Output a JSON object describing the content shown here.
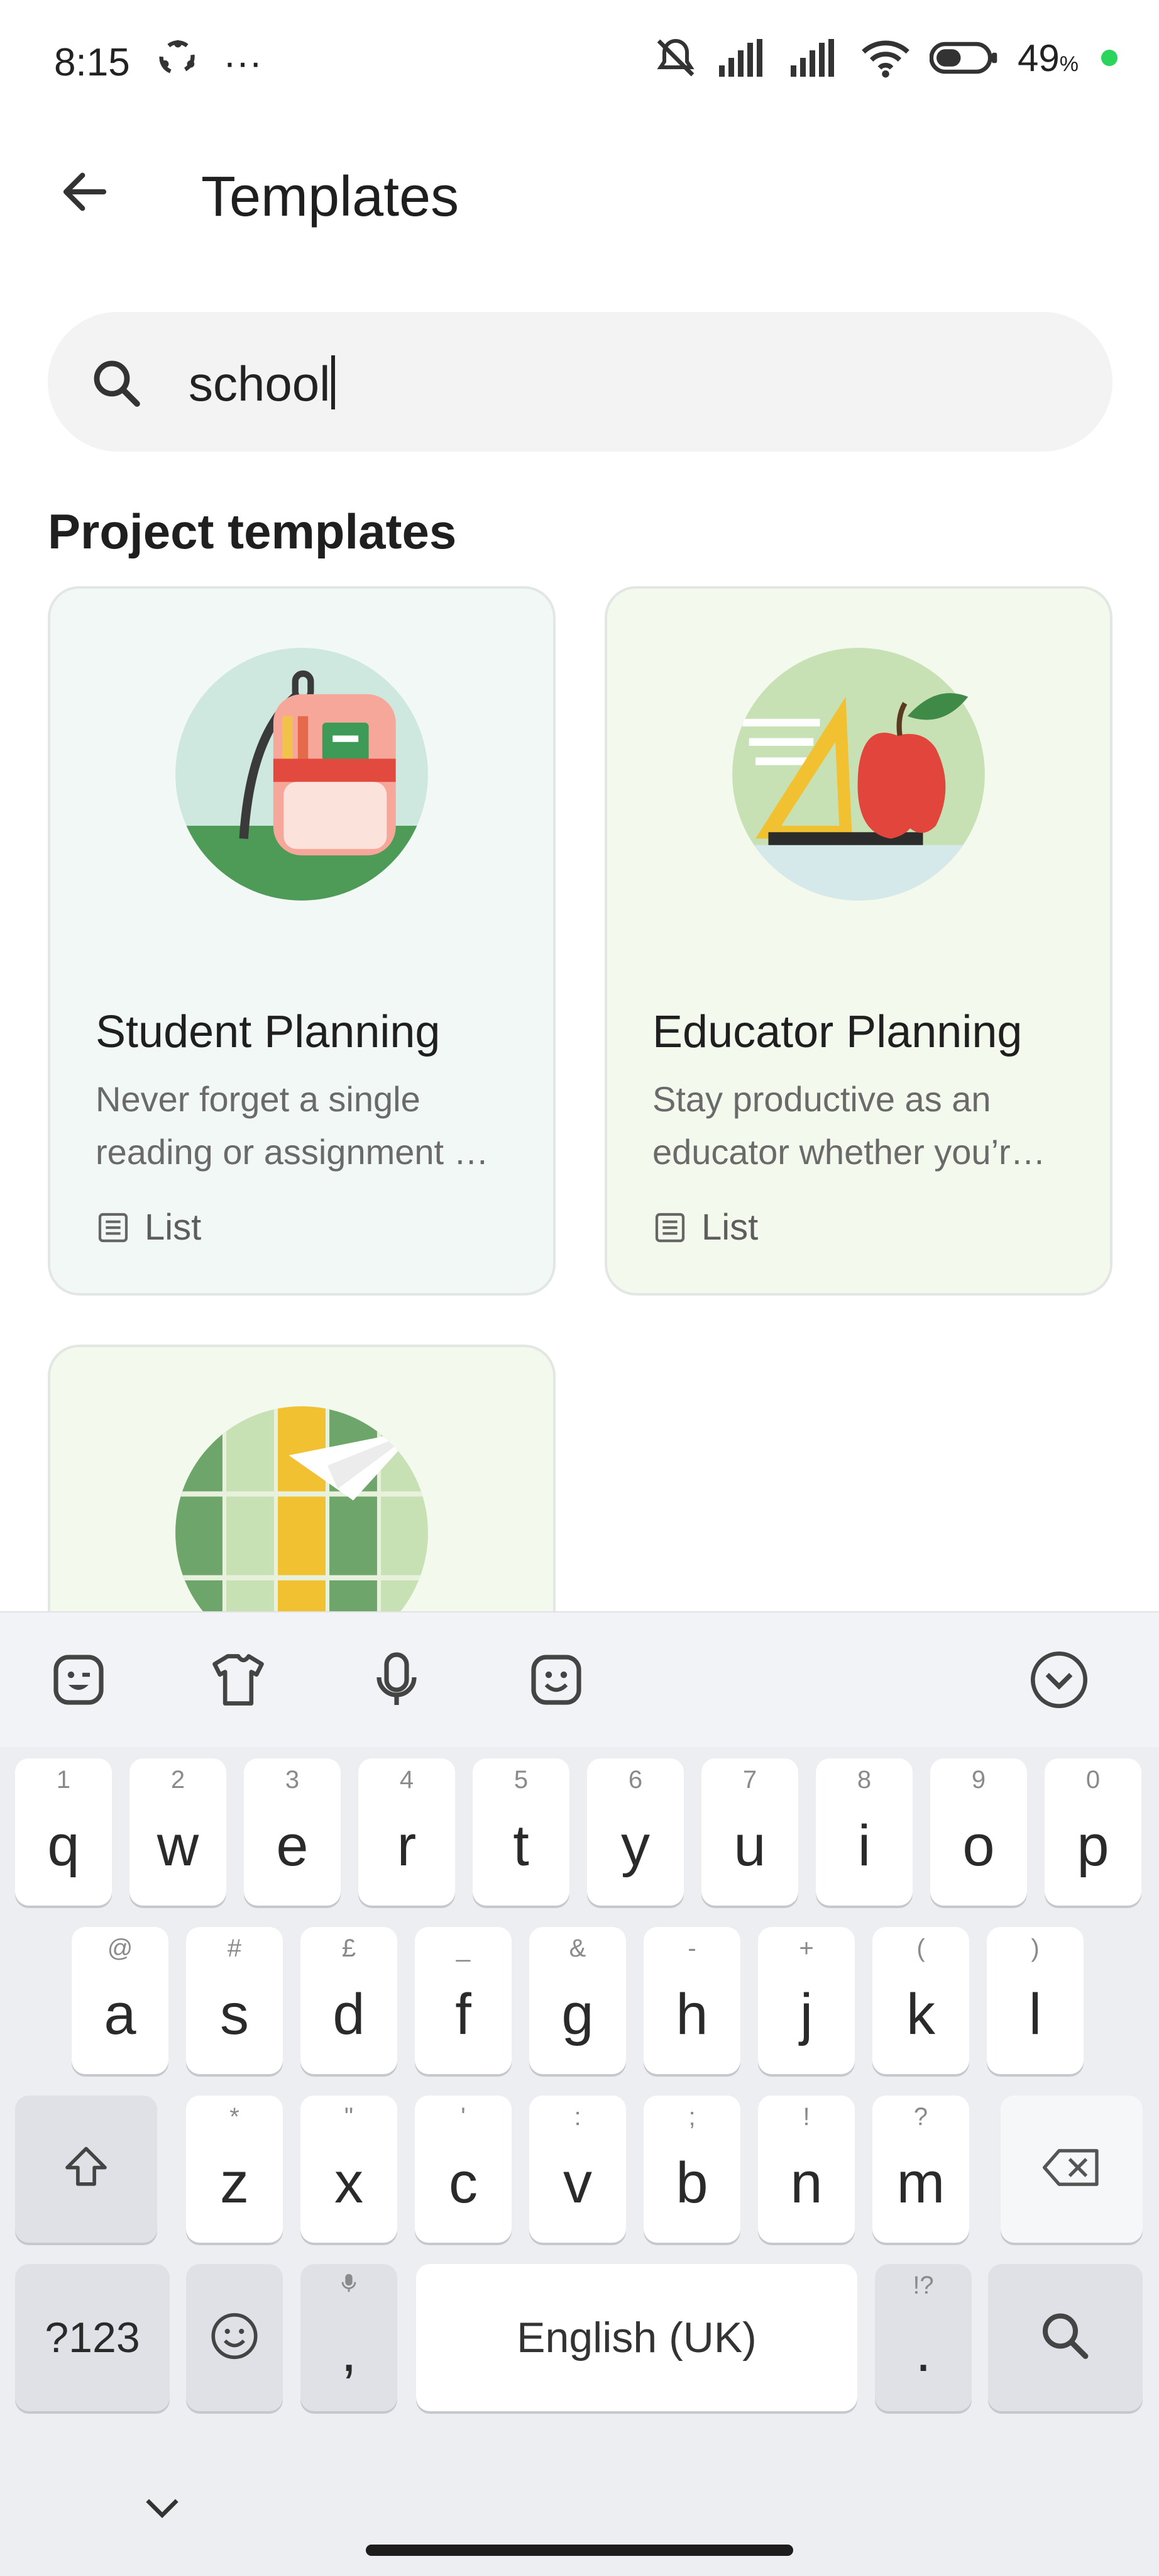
{
  "status_bar": {
    "time": "8:15",
    "dots": "···",
    "battery_percent": "49",
    "percent_sign": "%"
  },
  "header": {
    "title": "Templates"
  },
  "search": {
    "value": "school"
  },
  "section": {
    "title": "Project templates"
  },
  "cards": [
    {
      "title": "Student Planning",
      "description_lines": [
        "Never forget a single",
        "reading or assignment …"
      ],
      "type_label": "List",
      "illustration": "backpack-illustration"
    },
    {
      "title": "Educator Planning",
      "description_lines": [
        "Stay productive as an",
        "educator whether you’r…"
      ],
      "type_label": "List",
      "illustration": "apple-ruler-illustration"
    },
    {
      "title": "",
      "illustration": "lockers-paper-plane-illustration"
    }
  ],
  "keyboard": {
    "row1": [
      {
        "key": "q",
        "hint": "1"
      },
      {
        "key": "w",
        "hint": "2"
      },
      {
        "key": "e",
        "hint": "3"
      },
      {
        "key": "r",
        "hint": "4"
      },
      {
        "key": "t",
        "hint": "5"
      },
      {
        "key": "y",
        "hint": "6"
      },
      {
        "key": "u",
        "hint": "7"
      },
      {
        "key": "i",
        "hint": "8"
      },
      {
        "key": "o",
        "hint": "9"
      },
      {
        "key": "p",
        "hint": "0"
      }
    ],
    "row2": [
      {
        "key": "a",
        "hint": "@"
      },
      {
        "key": "s",
        "hint": "#"
      },
      {
        "key": "d",
        "hint": "£"
      },
      {
        "key": "f",
        "hint": "_"
      },
      {
        "key": "g",
        "hint": "&"
      },
      {
        "key": "h",
        "hint": "-"
      },
      {
        "key": "j",
        "hint": "+"
      },
      {
        "key": "k",
        "hint": "("
      },
      {
        "key": "l",
        "hint": ")"
      }
    ],
    "row3": [
      {
        "key": "z",
        "hint": "*"
      },
      {
        "key": "x",
        "hint": "\""
      },
      {
        "key": "c",
        "hint": "'"
      },
      {
        "key": "v",
        "hint": ":"
      },
      {
        "key": "b",
        "hint": ";"
      },
      {
        "key": "n",
        "hint": "!"
      },
      {
        "key": "m",
        "hint": "?"
      }
    ],
    "symbols_label": "?123",
    "comma": ",",
    "space_label": "English (UK)",
    "period": ".",
    "period_hint": "!?"
  }
}
